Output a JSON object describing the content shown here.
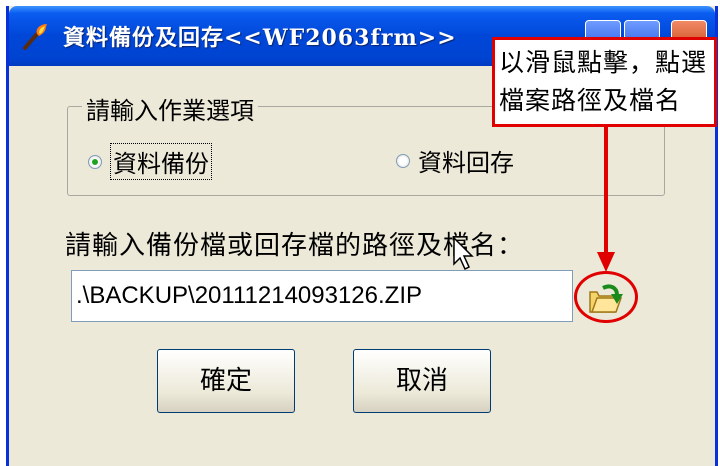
{
  "window": {
    "title": "資料備份及回存<<WF2063frm>>"
  },
  "options_group": {
    "legend": "請輸入作業選項",
    "radios": [
      {
        "label": "資料備份",
        "selected": true
      },
      {
        "label": "資料回存",
        "selected": false
      }
    ]
  },
  "path": {
    "label": "請輸入備份檔或回存檔的路徑及檔名：",
    "value": ".\\BACKUP\\20111214093126.ZIP"
  },
  "buttons": {
    "ok_label": "確定",
    "cancel_label": "取消"
  },
  "annotation": {
    "lines": [
      "以滑鼠點擊，點選",
      "檔案路徑及檔名"
    ],
    "color": "#e00000"
  },
  "icons": {
    "app": "torch-icon",
    "browse": "open-folder-icon"
  }
}
